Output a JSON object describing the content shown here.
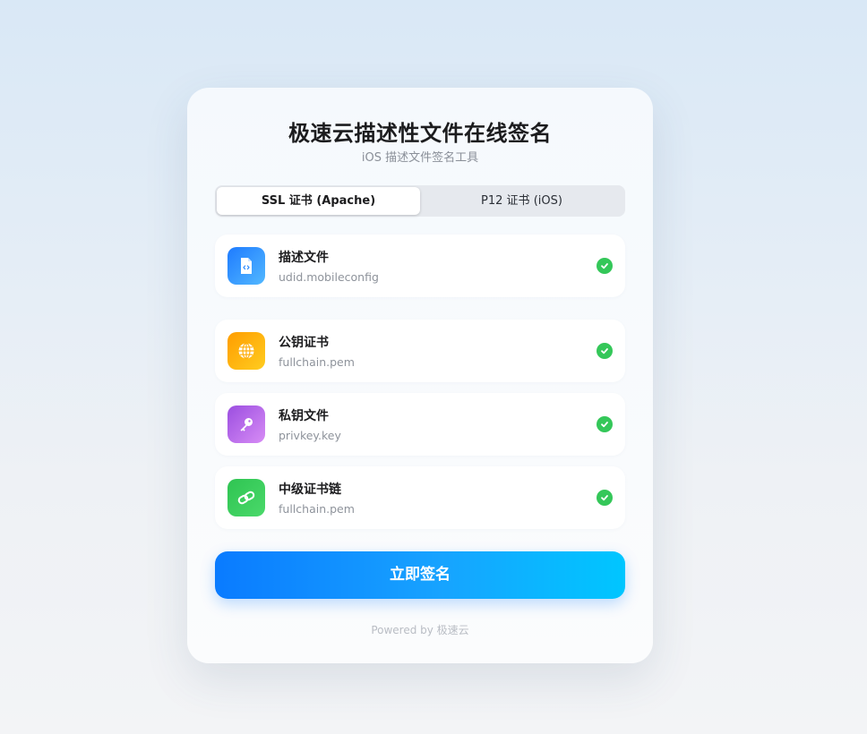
{
  "header": {
    "title": "极速云描述性文件在线签名",
    "subtitle": "iOS 描述文件签名工具"
  },
  "tabs": [
    {
      "label": "SSL 证书 (Apache)",
      "active": true
    },
    {
      "label": "P12 证书 (iOS)",
      "active": false
    }
  ],
  "files": [
    {
      "name": "描述文件",
      "file": "udid.mobileconfig",
      "icon": "document-code-icon",
      "color": "#2f8cff",
      "status": "uploaded"
    },
    {
      "name": "公钥证书",
      "file": "fullchain.pem",
      "icon": "globe-icon",
      "color": "#ffa500",
      "status": "uploaded"
    },
    {
      "name": "私钥文件",
      "file": "privkey.key",
      "icon": "key-icon",
      "color": "#b05ae0",
      "status": "uploaded"
    },
    {
      "name": "中级证书链",
      "file": "fullchain.pem",
      "icon": "link-icon",
      "color": "#34c759",
      "status": "uploaded"
    }
  ],
  "actions": {
    "sign_label": "立即签名"
  },
  "footer": {
    "powered": "Powered by 极速云"
  },
  "colors": {
    "accent": "#0a7bff",
    "success": "#34c759"
  }
}
